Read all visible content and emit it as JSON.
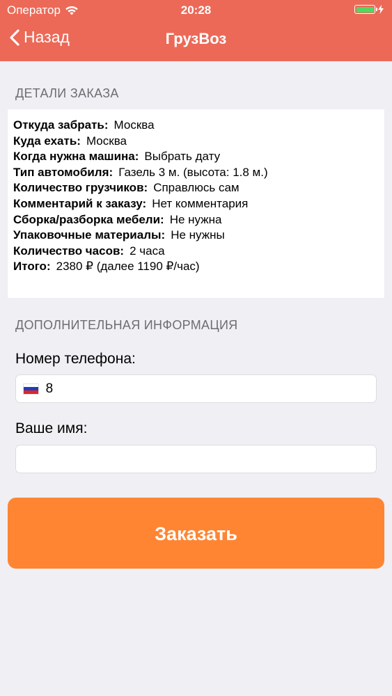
{
  "status_bar": {
    "carrier": "Оператор",
    "time": "20:28",
    "battery_percent": 100
  },
  "nav": {
    "back_label": "Назад",
    "title": "ГрузВоз"
  },
  "details": {
    "section_title": "ДЕТАЛИ ЗАКАЗА",
    "rows": [
      {
        "label": "Откуда забрать:",
        "value": "Москва"
      },
      {
        "label": "Куда ехать:",
        "value": "Москва"
      },
      {
        "label": "Когда нужна машина:",
        "value": "Выбрать дату"
      },
      {
        "label": "Тип автомобиля:",
        "value": "Газель 3 м. (высота: 1.8 м.)"
      },
      {
        "label": "Количество грузчиков:",
        "value": "Справлюсь сам"
      },
      {
        "label": "Комментарий к заказу:",
        "value": "Нет комментария"
      },
      {
        "label": "Сборка/разборка мебели:",
        "value": "Не нужна"
      },
      {
        "label": "Упаковочные материалы:",
        "value": "Не нужны"
      },
      {
        "label": "Количество часов:",
        "value": "2 часа"
      },
      {
        "label": "Итого:",
        "value": "2380 ₽ (далее 1190 ₽/час)"
      }
    ]
  },
  "additional": {
    "section_title": "ДОПОЛНИТЕЛЬНАЯ ИНФОРМАЦИЯ",
    "phone_label": "Номер телефона:",
    "phone_value": "8",
    "name_label": "Ваше имя:",
    "name_value": ""
  },
  "order_button": {
    "label": "Заказать"
  },
  "colors": {
    "header": "#ec6957",
    "button": "#ff8533",
    "background": "#efeff4",
    "battery": "#4cd964"
  },
  "icons": {
    "wifi": "wifi-icon",
    "back": "chevron-left-icon",
    "flag": "russia-flag-icon",
    "charging": "charging-icon"
  }
}
